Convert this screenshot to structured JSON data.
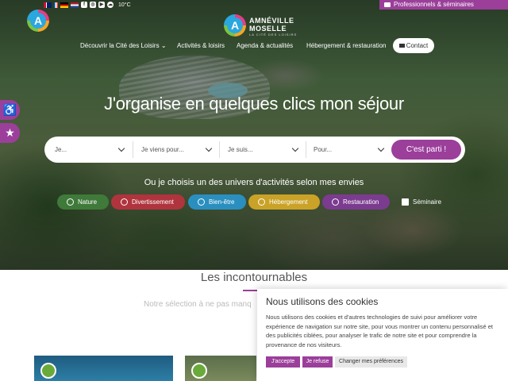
{
  "topbar": {
    "weather": "10°C",
    "pro_link": "Professionnels & séminaires"
  },
  "logo": {
    "line1": "AMNÉVILLE",
    "line2": "MOSELLE",
    "line3": "LA CITÉ DES LOISIRS",
    "mark": "A"
  },
  "nav": {
    "items": [
      {
        "label": "Découvrir la Cité des Loisirs ⌄"
      },
      {
        "label": "Activités & loisirs"
      },
      {
        "label": "Agenda & actualités"
      },
      {
        "label": "Hébergement & restauration"
      }
    ],
    "contact": "Contact"
  },
  "hero": {
    "headline": "J'organise en quelques clics mon séjour",
    "subtitle": "Ou je choisis un des univers d'activités selon mes envies"
  },
  "search": {
    "fields": [
      {
        "placeholder": "Je..."
      },
      {
        "placeholder": "Je viens pour..."
      },
      {
        "placeholder": "Je suis..."
      },
      {
        "placeholder": "Pour..."
      }
    ],
    "submit": "C'est parti !"
  },
  "categories": [
    {
      "label": "Nature",
      "color": "#3f7a3a"
    },
    {
      "label": "Divertissement",
      "color": "#b0343d"
    },
    {
      "label": "Bien-être",
      "color": "#2a8fbf"
    },
    {
      "label": "Hébergement",
      "color": "#c9a227"
    },
    {
      "label": "Restauration",
      "color": "#7b3b8f"
    },
    {
      "label": "Séminaire",
      "color": "transparent"
    }
  ],
  "highlights": {
    "title": "Les incontournables",
    "subtitle": "Notre sélection à ne pas manq"
  },
  "cookie": {
    "title": "Nous utilisons des cookies",
    "text": "Nous utilisons des cookies et d'autres technologies de suivi pour améliorer votre expérience de navigation sur notre site, pour vous montrer un contenu personnalisé et des publicités ciblées, pour analyser le trafic de notre site et pour comprendre la provenance de nos visiteurs.",
    "accept": "J'accepte",
    "refuse": "Je refuse",
    "prefs": "Changer mes préférences"
  },
  "colors": {
    "accent": "#9b3f9b"
  }
}
